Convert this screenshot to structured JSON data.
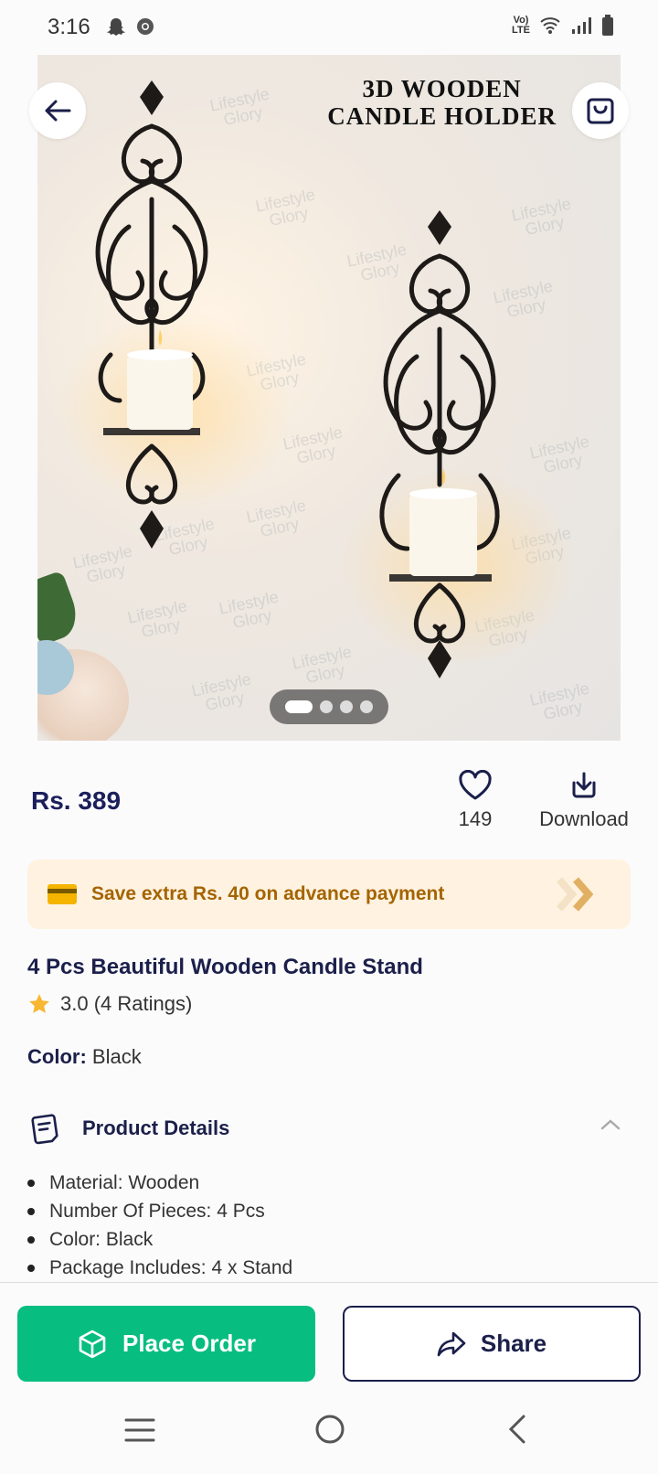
{
  "status_bar": {
    "time": "3:16",
    "network_label": "LTE",
    "volte_label": "Vo)"
  },
  "hero": {
    "title_line1": "3D WOODEN",
    "title_line2": "CANDLE HOLDER",
    "watermark_line1": "Lifestyle",
    "watermark_line2": "Glory",
    "carousel_count": 4,
    "carousel_active": 1
  },
  "product": {
    "price": "Rs. 389",
    "wishlist_count": "149",
    "download_label": "Download",
    "offer_text": "Save extra Rs. 40 on advance payment",
    "title": "4 Pcs Beautiful Wooden Candle Stand",
    "rating_text": "3.0 (4 Ratings)",
    "color_label": "Color:",
    "color_value": "Black"
  },
  "details": {
    "heading": "Product Details",
    "items": [
      "Material: Wooden",
      "Number Of Pieces: 4 Pcs",
      "Color: Black",
      "Package Includes: 4 x Stand"
    ]
  },
  "actions": {
    "place_order": "Place Order",
    "share": "Share"
  },
  "colors": {
    "primary_green": "#08bd80",
    "navy": "#1b1f4a",
    "offer_bg": "#fff2e0",
    "offer_text": "#a46400",
    "star": "#f7b731"
  }
}
